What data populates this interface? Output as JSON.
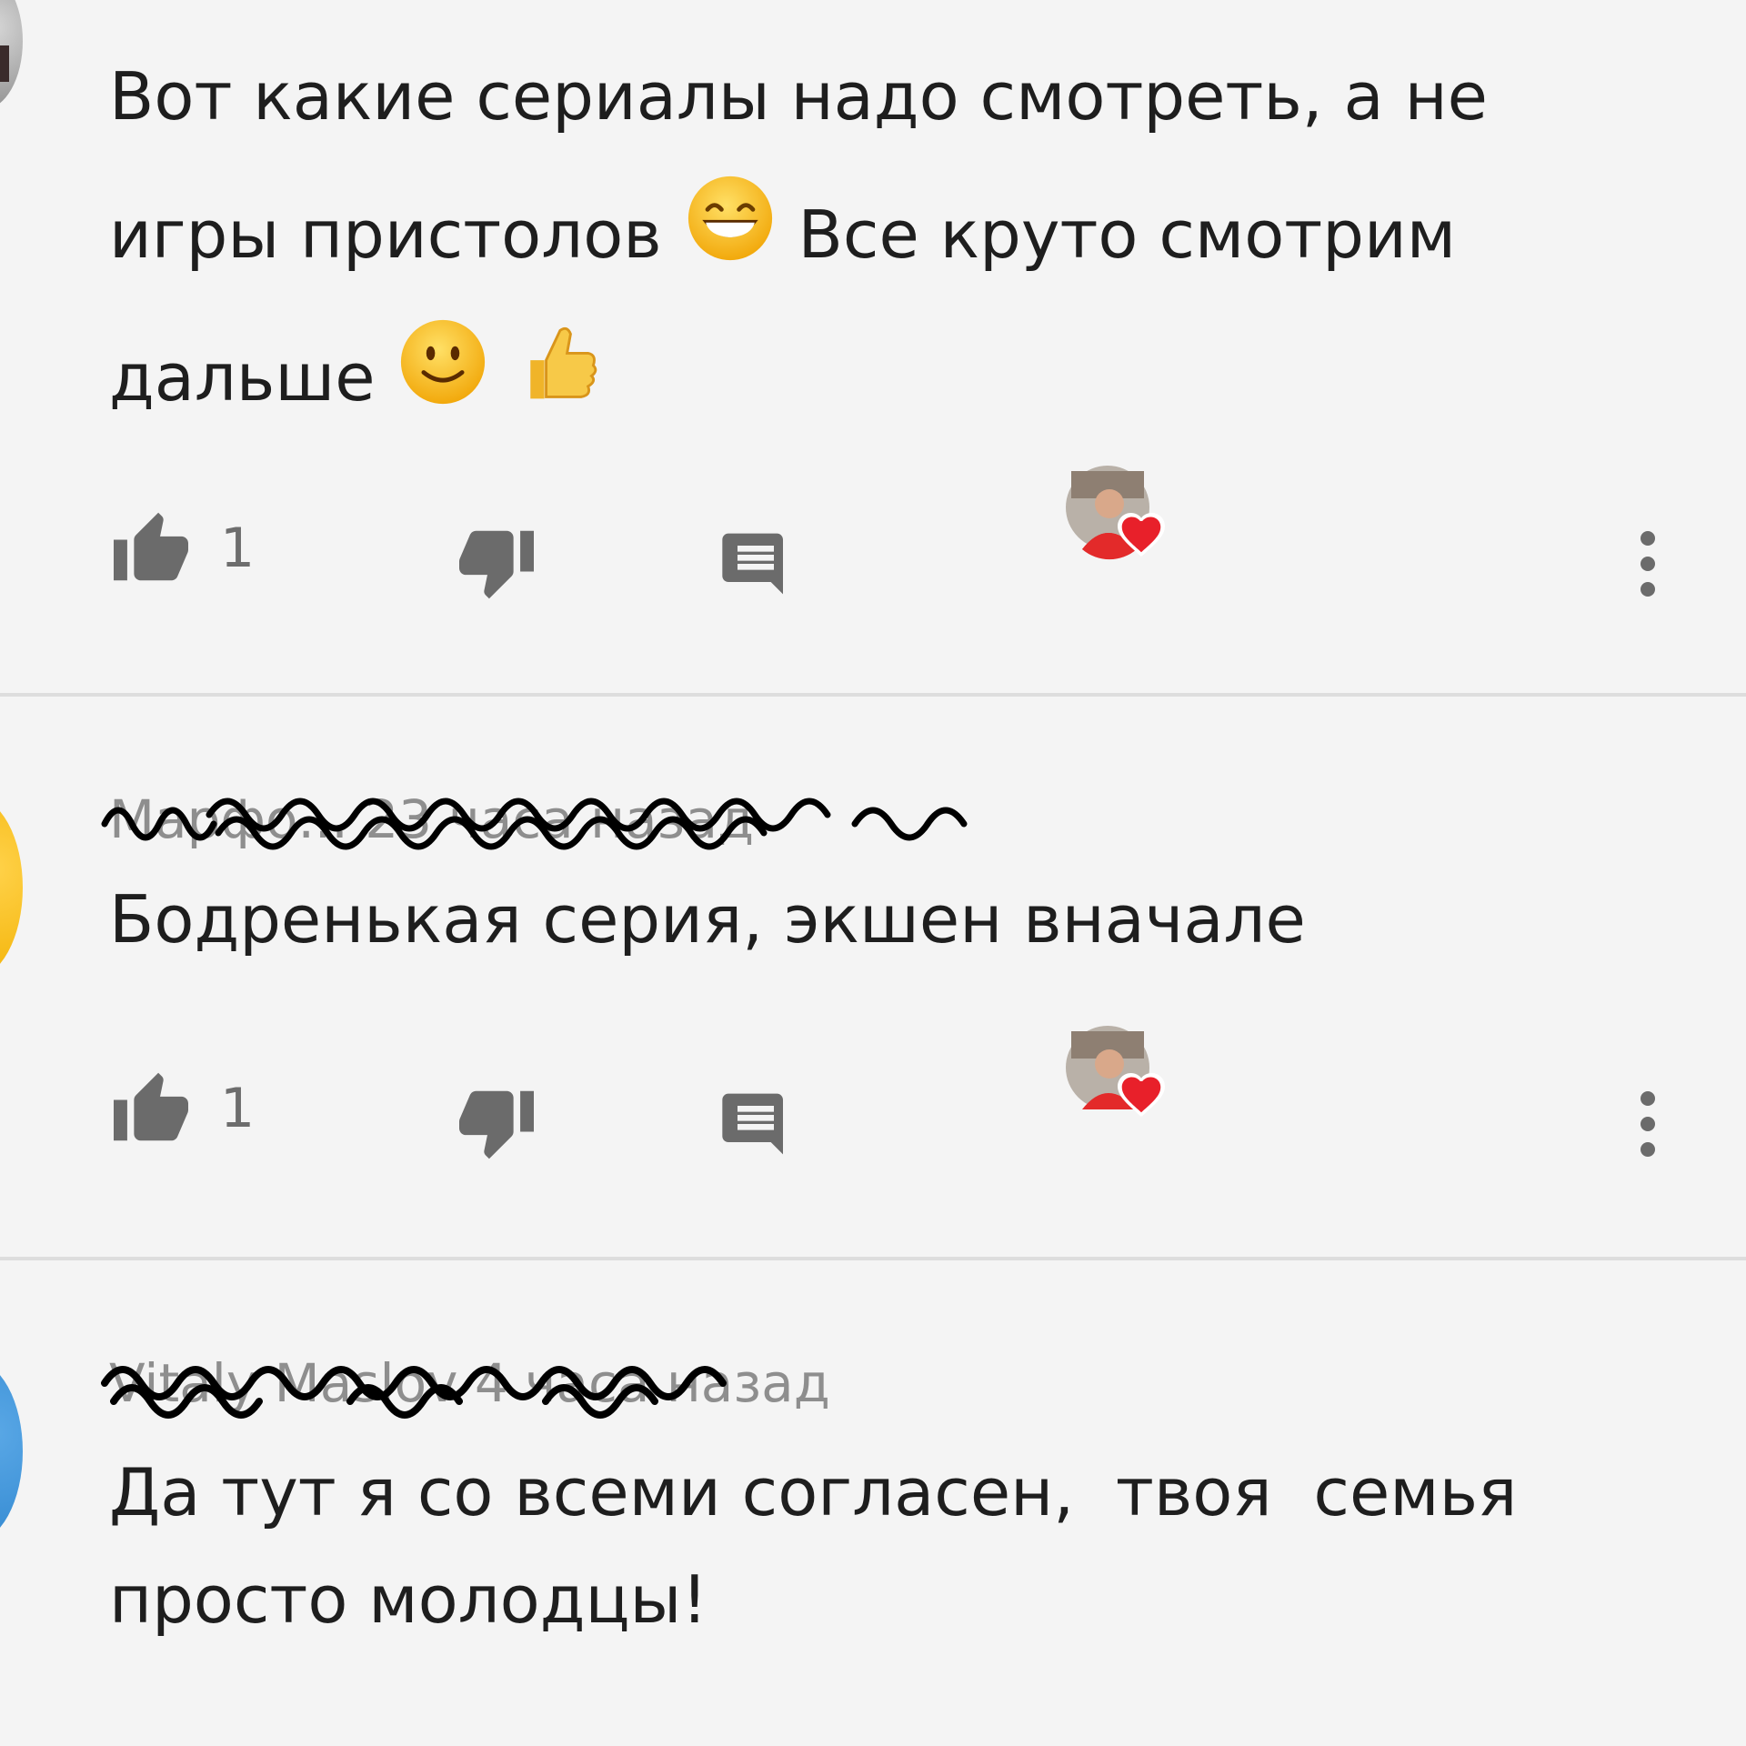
{
  "comments": [
    {
      "author": "",
      "time": "",
      "text_line1": "Вот какие сериалы надо смотреть, а не",
      "text_line2a": "игры пристолов",
      "text_line2b": "Все круто смотрим",
      "text_line3": "дальше",
      "likes": "1",
      "emojis": [
        "grinning-face",
        "slightly-smiling-face",
        "thumbs-up"
      ]
    },
    {
      "author": "Марфо...",
      "time": "23 часа назад",
      "meta_visible": "Марфо... 23 часа назад",
      "text": "Бодренькая серия, экшен вначале",
      "likes": "1"
    },
    {
      "author": "Vitaly Maslov",
      "time": "4 часа назад",
      "meta_visible": "Vitaly Maslov 4 часа назад",
      "text_line1": "Да тут я со всеми согласен,  твоя  семья",
      "text_line2": "просто молодцы!"
    }
  ],
  "colors": {
    "background": "#f4f4f4",
    "icon_gray": "#6b6b6b",
    "heart_red": "#e8202a",
    "divider": "#dddddd"
  },
  "icons": [
    "thumbs-up-icon",
    "thumbs-down-icon",
    "reply-icon",
    "creator-heart-icon",
    "more-vert-icon"
  ]
}
